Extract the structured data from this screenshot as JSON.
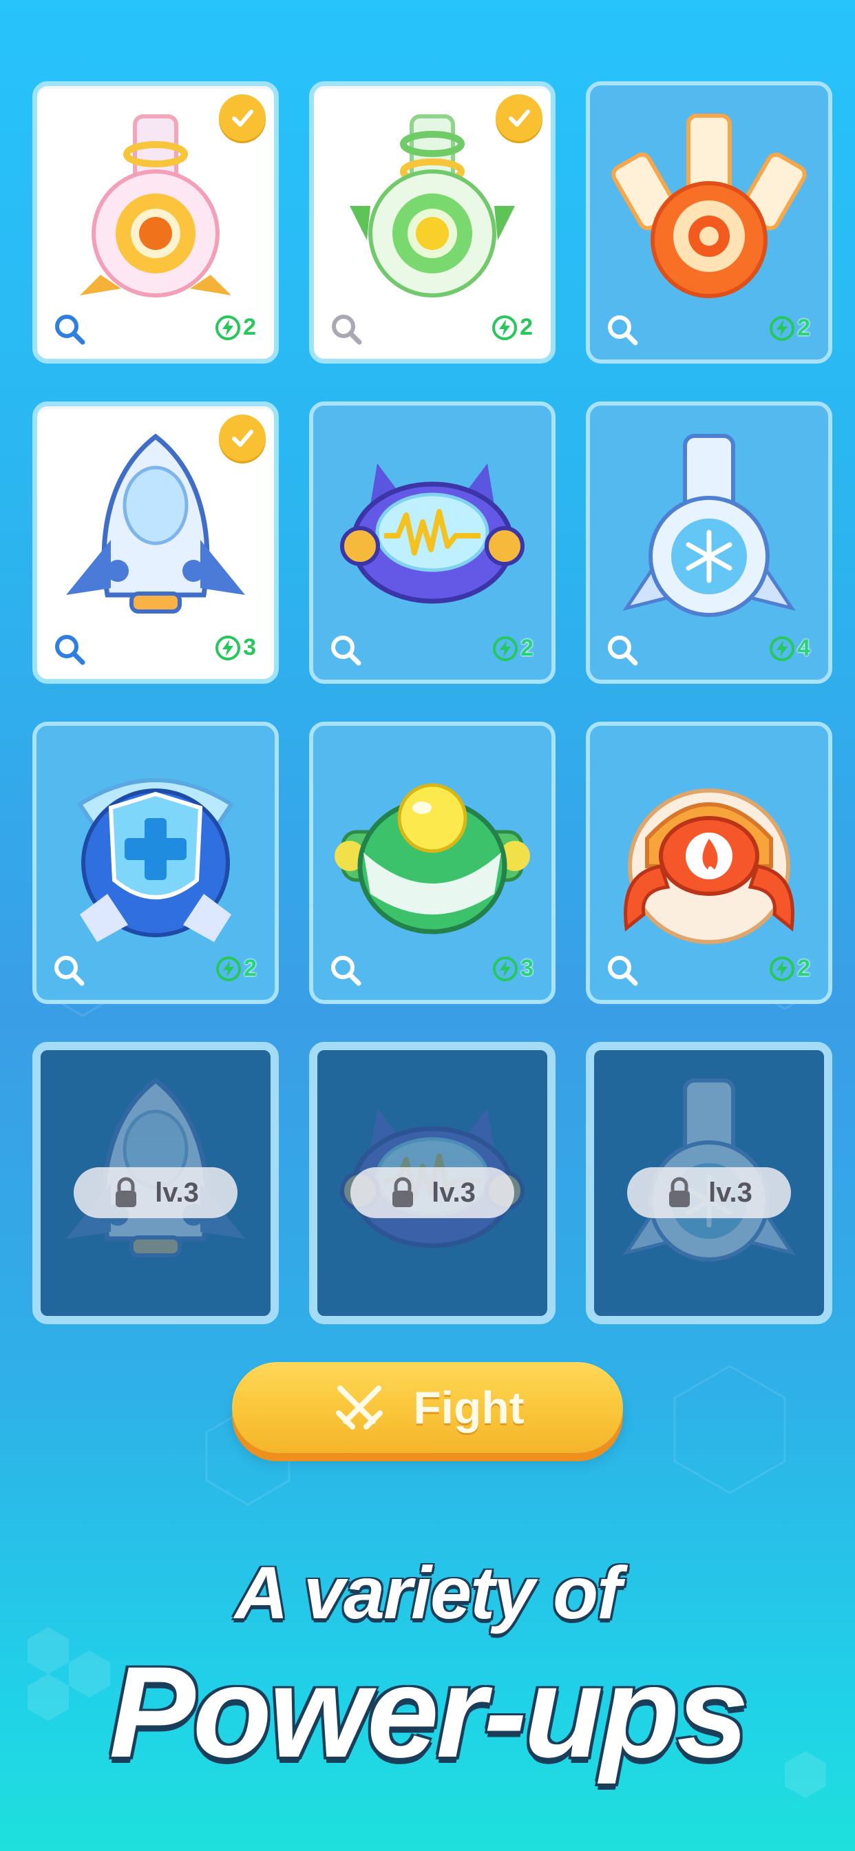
{
  "powerups": [
    {
      "id": "cannon-orange",
      "state": "selected",
      "cost": "2",
      "icon": "orange-cannon-icon"
    },
    {
      "id": "cannon-green",
      "state": "selected",
      "cost": "2",
      "icon": "green-cannon-icon"
    },
    {
      "id": "triple-cannon",
      "state": "normal",
      "cost": "2",
      "icon": "triple-cannon-icon"
    },
    {
      "id": "rocket",
      "state": "selected",
      "cost": "3",
      "icon": "rocket-icon"
    },
    {
      "id": "pulse-ship",
      "state": "normal",
      "cost": "2",
      "icon": "pulse-ship-icon"
    },
    {
      "id": "ice-cannon",
      "state": "normal",
      "cost": "4",
      "icon": "ice-cannon-icon"
    },
    {
      "id": "shield",
      "state": "normal",
      "cost": "2",
      "icon": "shield-plus-icon"
    },
    {
      "id": "green-orb",
      "state": "normal",
      "cost": "3",
      "icon": "green-orb-ship-icon"
    },
    {
      "id": "fire-crab",
      "state": "normal",
      "cost": "2",
      "icon": "fire-crab-icon"
    },
    {
      "id": "rocket-locked",
      "state": "locked",
      "lock_label": "lv.3",
      "icon": "rocket-icon"
    },
    {
      "id": "pulse-locked",
      "state": "locked",
      "lock_label": "lv.3",
      "icon": "pulse-ship-icon"
    },
    {
      "id": "ice-locked",
      "state": "locked",
      "lock_label": "lv.3",
      "icon": "ice-cannon-icon"
    }
  ],
  "fight_button": {
    "label": "Fight",
    "icon": "crossed-swords-icon"
  },
  "tagline": {
    "line1": "A variety of",
    "line2": "Power-ups"
  },
  "colors": {
    "selected_bg": "#ffffff",
    "card_border": "#a8e2fb",
    "locked_bg": "#22679c",
    "check": "#f9c031",
    "energy": "#27c85b",
    "button": "#fac539"
  }
}
